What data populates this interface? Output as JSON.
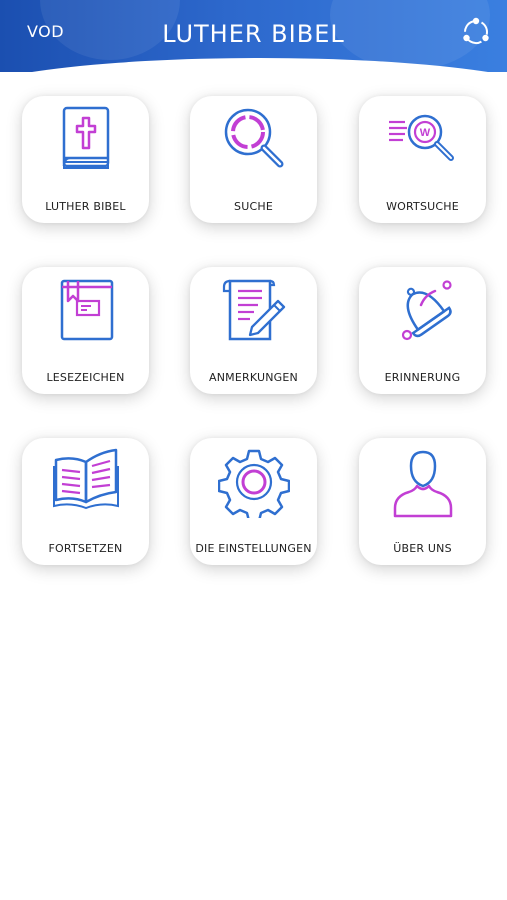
{
  "header": {
    "left_label": "VOD",
    "title": "LUTHER BIBEL",
    "share_icon": "share-icon"
  },
  "tiles": [
    {
      "label": "LUTHER BIBEL",
      "icon": "bible-icon"
    },
    {
      "label": "SUCHE",
      "icon": "search-icon"
    },
    {
      "label": "WORTSUCHE",
      "icon": "word-search-icon"
    },
    {
      "label": "LESEZEICHEN",
      "icon": "bookmark-icon"
    },
    {
      "label": "ANMERKUNGEN",
      "icon": "notes-icon"
    },
    {
      "label": "ERINNERUNG",
      "icon": "bell-icon"
    },
    {
      "label": "FORTSETZEN",
      "icon": "open-book-icon"
    },
    {
      "label": "DIE EINSTELLUNGEN",
      "icon": "gear-icon"
    },
    {
      "label": "ÜBER UNS",
      "icon": "user-icon"
    }
  ],
  "colors": {
    "header_start": "#1b4fb0",
    "header_end": "#3a7fe0",
    "icon_blue": "#2f6fd0",
    "icon_magenta": "#c23fd4"
  }
}
